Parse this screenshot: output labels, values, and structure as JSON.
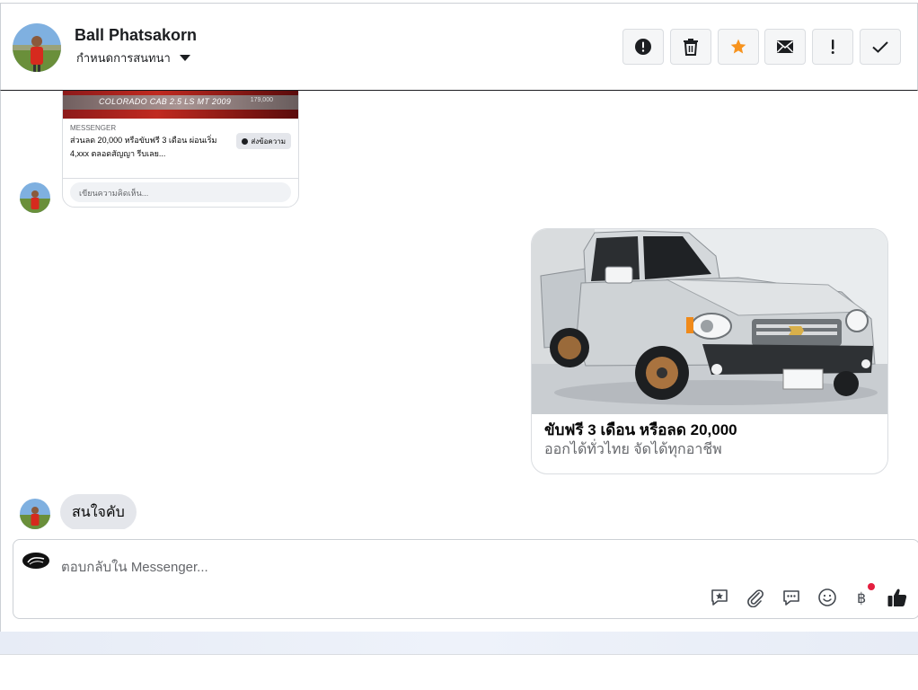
{
  "header": {
    "name": "Ball Phatsakorn",
    "assign_label": "กำหนดการสนทนา",
    "actions": [
      {
        "icon": "alert-circle-icon",
        "name": "spam-button"
      },
      {
        "icon": "trash-icon",
        "name": "delete-button"
      },
      {
        "icon": "star-icon",
        "name": "star-button"
      },
      {
        "icon": "envelope-icon",
        "name": "mark-unread-button"
      },
      {
        "icon": "exclamation-icon",
        "name": "follow-up-button"
      },
      {
        "icon": "checkmark-icon",
        "name": "mark-done-button"
      }
    ],
    "star_color": "#f7931e"
  },
  "shared_post": {
    "banner_text": "COLORADO CAB 2.5 LS MT 2009",
    "banner_price": "179,000",
    "kicker": "MESSENGER",
    "text": "ส่วนลด 20,000 หรือขับฟรี 3 เดือน ผ่อนเริ่ม 4,xxx ตลอดสัญญา รีบเลย...",
    "send_label": "ส่งข้อความ",
    "comment_placeholder": "เขียนความคิดเห็น..."
  },
  "ad_card": {
    "title": "ขับฟรี 3 เดือน หรือลด 20,000",
    "subtitle": "ออกได้ทั่วไทย จัดได้ทุกอาชีพ"
  },
  "incoming_message": "สนใจคับ",
  "composer": {
    "placeholder": "ตอบกลับใน Messenger...",
    "tools": [
      "saved-reply-icon",
      "attachment-icon",
      "chat-bubble-icon",
      "emoji-icon",
      "baht-payment-icon",
      "thumbs-up-icon"
    ],
    "badge_color": "#e41e3f"
  }
}
